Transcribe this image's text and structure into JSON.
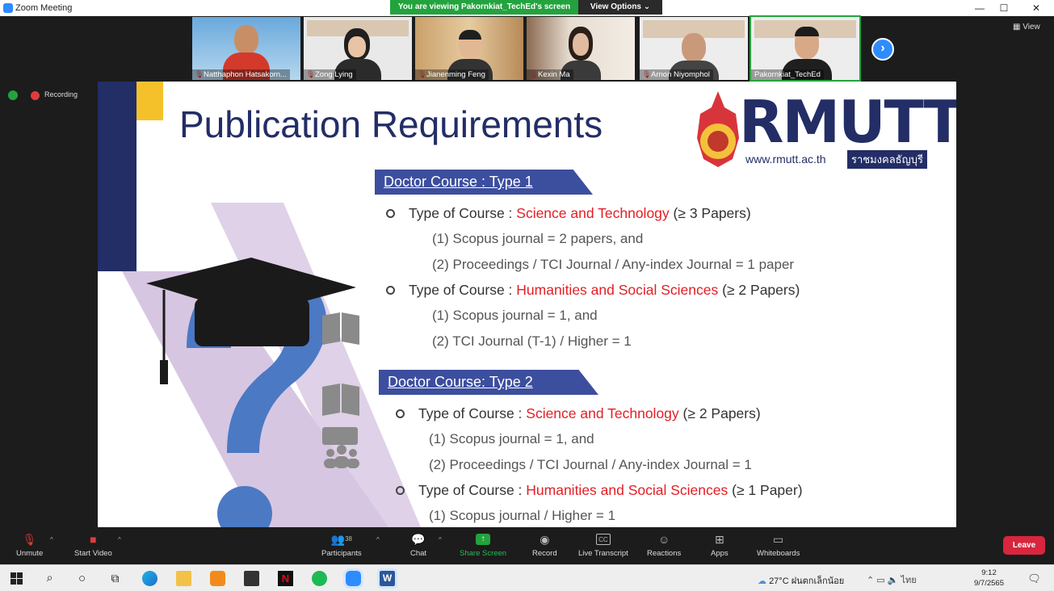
{
  "window": {
    "title": "Zoom Meeting"
  },
  "share_banner": "You are viewing Pakornkiat_TechEd's screen",
  "view_options": "View Options",
  "view_button": "View",
  "status": {
    "recording": "Recording"
  },
  "participants": [
    {
      "name": "Natthaphon Hatsakorn..."
    },
    {
      "name": "Zong Lying"
    },
    {
      "name": "Jianenming Feng"
    },
    {
      "name": "Kexin Ma"
    },
    {
      "name": "Arnon Niyomphol"
    },
    {
      "name": "Pakornkiat_TechEd"
    }
  ],
  "slide": {
    "title": "Publication Requirements",
    "logo": {
      "text": "RMUTT",
      "url": "www.rmutt.ac.th",
      "thai": "ราชมงคลธัญบุรี"
    },
    "sections": [
      {
        "heading": "Doctor Course : Type 1",
        "items": [
          {
            "prefix": "Type of Course : ",
            "field": "Science and Technology",
            "suffix": " (≥ 3 Papers)",
            "subs": [
              "(1) Scopus journal = 2 papers, and",
              "(2) Proceedings / TCI Journal / Any-index Journal = 1 paper"
            ]
          },
          {
            "prefix": "Type of Course : ",
            "field": "Humanities and Social Sciences",
            "suffix": " (≥ 2 Papers)",
            "subs": [
              "(1) Scopus journal = 1, and",
              "(2) TCI Journal (T-1) / Higher = 1"
            ]
          }
        ]
      },
      {
        "heading": "Doctor Course: Type 2",
        "items": [
          {
            "prefix": "Type of Course : ",
            "field": "Science and Technology",
            "suffix": " (≥ 2 Papers)",
            "subs": [
              "(1) Scopus journal = 1, and",
              "(2) Proceedings / TCI Journal / Any-index Journal = 1"
            ]
          },
          {
            "prefix": "Type of Course : ",
            "field": "Humanities and Social Sciences",
            "suffix": " (≥ 1 Paper)",
            "subs": [
              "(1) Scopus journal / Higher = 1"
            ]
          }
        ]
      }
    ]
  },
  "toolbar": {
    "unmute": "Unmute",
    "start_video": "Start Video",
    "participants": "Participants",
    "participants_count": "38",
    "chat": "Chat",
    "share_screen": "Share Screen",
    "record": "Record",
    "live_transcript": "Live Transcript",
    "reactions": "Reactions",
    "apps": "Apps",
    "whiteboards": "Whiteboards",
    "leave": "Leave"
  },
  "taskbar": {
    "weather": "27°C  ฝนตกเล็กน้อย",
    "lang": "ไทย",
    "time": "9:12",
    "date": "9/7/2565"
  },
  "colors": {
    "zoom_blue": "#2d8cff",
    "share_green": "#23a33e",
    "leave_red": "#d7263d",
    "slide_navy": "#232d66",
    "banner_blue": "#3c4e9e",
    "field_red": "#e31e24"
  }
}
